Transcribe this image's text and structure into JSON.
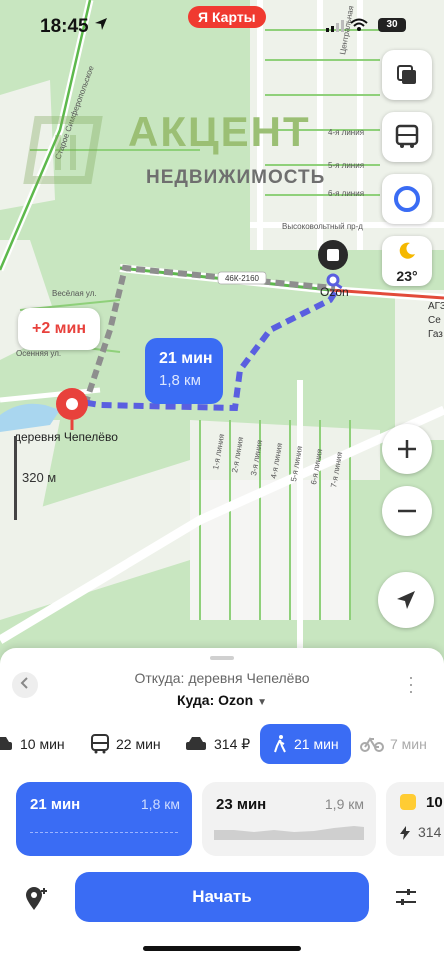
{
  "status_bar": {
    "time": "18:45",
    "battery": "30"
  },
  "map": {
    "brand_badge": "Я Карты",
    "watermark": {
      "line1": "АКЦЕНТ",
      "line2": "НЕДВИЖИМОСТЬ"
    },
    "weather_temp": "23°",
    "alt_route_delta": "+2 мин",
    "route_bubble": {
      "time": "21 мин",
      "distance": "1,8 км"
    },
    "village_label": "деревня Чепелёво",
    "destination_label": "Ozon",
    "road_badge": "46К-2160",
    "scale": "320 м",
    "fuel_label": [
      "АГЗС Се",
      "Газ"
    ],
    "street_labels": [
      "Весёлая ул.",
      "Осенняя ул.",
      "Старое Симферопольское",
      "Центральная",
      "4-я линия",
      "5-я линия",
      "6-я линия",
      "Высоковольтный пр-д",
      "1-я линия",
      "2-я линия",
      "3-я линия",
      "4-я линия",
      "5-я линия",
      "6-я линия",
      "7-я линия"
    ]
  },
  "sheet": {
    "from": "Откуда: деревня Чепелёво",
    "to": "Куда: Ozon",
    "modes": [
      {
        "name": "car",
        "label": "10 мин"
      },
      {
        "name": "transit",
        "label": "22 мин"
      },
      {
        "name": "taxi",
        "label": "314 ₽"
      },
      {
        "name": "walk",
        "label": "21 мин",
        "active": true
      },
      {
        "name": "bike",
        "label": "7 мин"
      }
    ],
    "cards": [
      {
        "time": "21 мин",
        "distance": "1,8 км"
      },
      {
        "time": "23 мин",
        "distance": "1,9 км"
      },
      {
        "price_top": "10",
        "price_bottom": "314"
      }
    ],
    "start_label": "Начать"
  },
  "colors": {
    "accent": "#3a6cf4",
    "alert": "#e8413c",
    "map_green": "#c8e6c0"
  }
}
